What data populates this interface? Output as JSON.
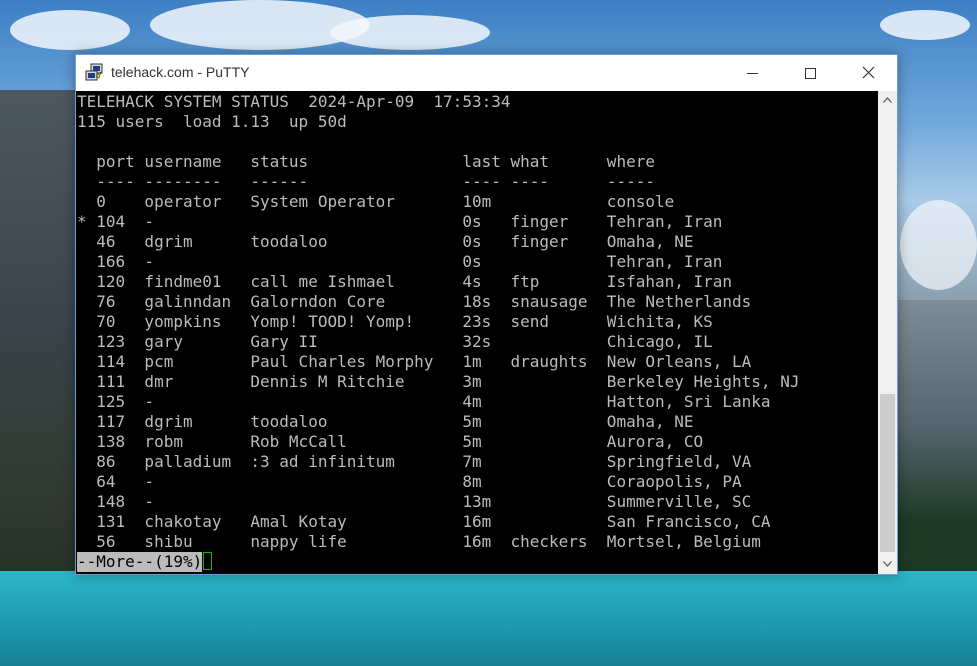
{
  "window": {
    "title": "telehack.com - PuTTY",
    "minimize_label": "—",
    "maximize_label": "☐",
    "close_label": "✕"
  },
  "icons": {
    "app": "putty-icon",
    "minimize": "minimize-icon",
    "maximize": "maximize-icon",
    "close": "close-icon",
    "scroll_up": "scroll-up-arrow-icon",
    "scroll_down": "scroll-down-arrow-icon"
  },
  "terminal": {
    "header_line1": "TELEHACK SYSTEM STATUS  2024-Apr-09  17:53:34",
    "header_line2": "115 users  load 1.13  up 50d",
    "columns_line": "  port username   status                last what      where",
    "rule_line": "  ---- --------   ------                ---- ----      -----",
    "rows": [
      "  0    operator   System Operator       10m            console",
      "* 104  -                                0s   finger    Tehran, Iran",
      "  46   dgrim      toodaloo              0s   finger    Omaha, NE",
      "  166  -                                0s             Tehran, Iran",
      "  120  findme01   call me Ishmael       4s   ftp       Isfahan, Iran",
      "  76   galinndan  Galorndon Core        18s  snausage  The Netherlands",
      "  70   yompkins   Yomp! TOOD! Yomp!     23s  send      Wichita, KS",
      "  123  gary       Gary II               32s            Chicago, IL",
      "  114  pcm        Paul Charles Morphy   1m   draughts  New Orleans, LA",
      "  111  dmr        Dennis M Ritchie      3m             Berkeley Heights, NJ",
      "  125  -                                4m             Hatton, Sri Lanka",
      "  117  dgrim      toodaloo              5m             Omaha, NE",
      "  138  robm       Rob McCall            5m             Aurora, CO",
      "  86   palladium  :3 ad infinitum       7m             Springfield, VA",
      "  64   -                                8m             Coraopolis, PA",
      "  148  -                                13m            Summerville, SC",
      "  131  chakotay   Amal Kotay            16m            San Francisco, CA",
      "  56   shibu      nappy life            16m  checkers  Mortsel, Belgium"
    ],
    "more_prompt": "--More--(19%)",
    "scroll_position_percent": 62
  }
}
